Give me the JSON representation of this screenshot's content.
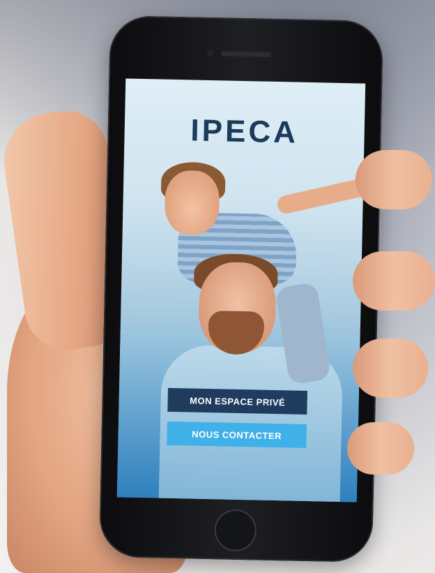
{
  "app": {
    "logo_text": "IPECA"
  },
  "actions": {
    "primary_label": "MON ESPACE PRIVÉ",
    "secondary_label": "NOUS CONTACTER"
  },
  "colors": {
    "primary_button": "#1f3c5f",
    "secondary_button": "#3fb0e8",
    "logo": "#1b3a5c"
  }
}
